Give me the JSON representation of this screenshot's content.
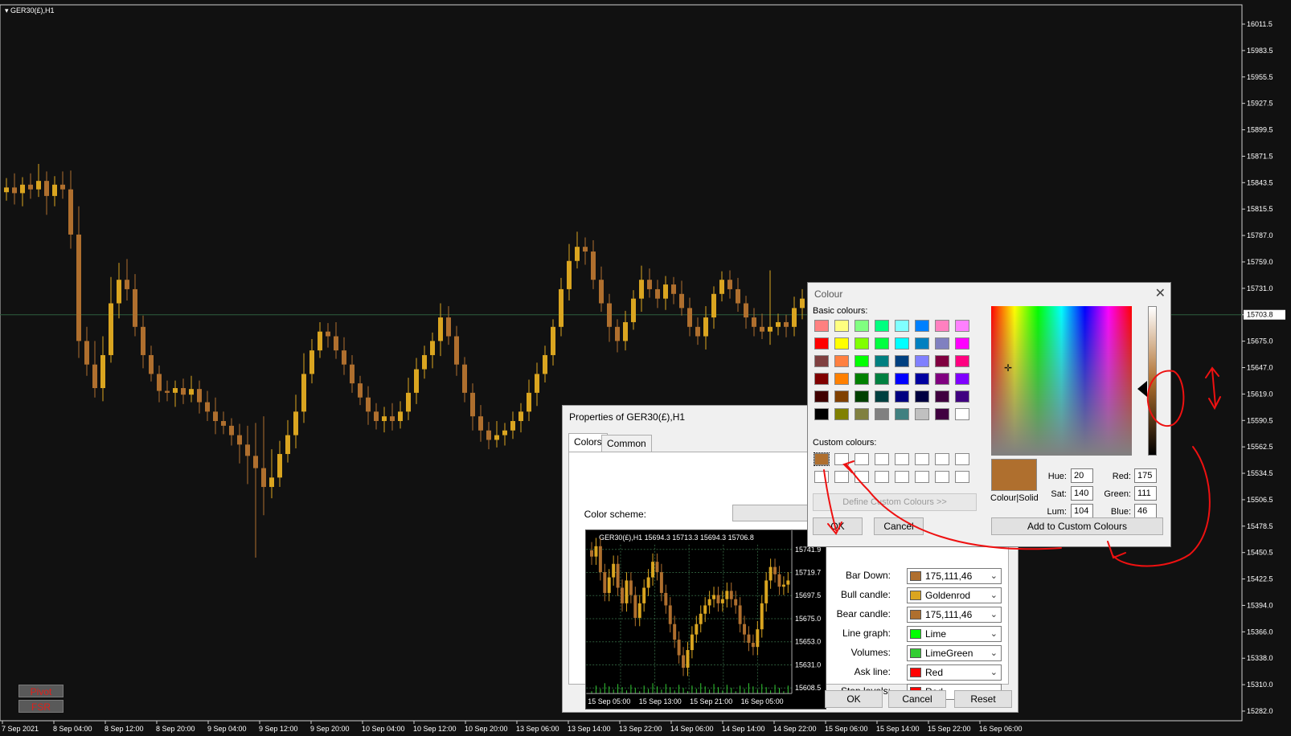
{
  "chart": {
    "title": "GER30(£),H1",
    "price_labels": [
      "16011.5",
      "15983.5",
      "15955.5",
      "15927.5",
      "15899.5",
      "15871.5",
      "15843.5",
      "15815.5",
      "15787.0",
      "15759.0",
      "15731.0",
      "15703.8",
      "15675.0",
      "15647.0",
      "15619.0",
      "15590.5",
      "15562.5",
      "15534.5",
      "15506.5",
      "15478.5",
      "15450.5",
      "15422.5",
      "15394.0",
      "15366.0",
      "15338.0",
      "15310.0",
      "15282.0"
    ],
    "current_price": "15703.8",
    "time_labels": [
      "7 Sep 2021",
      "8 Sep 04:00",
      "8 Sep 12:00",
      "8 Sep 20:00",
      "9 Sep 04:00",
      "9 Sep 12:00",
      "9 Sep 20:00",
      "10 Sep 04:00",
      "10 Sep 12:00",
      "10 Sep 20:00",
      "13 Sep 06:00",
      "13 Sep 14:00",
      "13 Sep 22:00",
      "14 Sep 06:00",
      "14 Sep 14:00",
      "14 Sep 22:00",
      "15 Sep 06:00",
      "15 Sep 14:00",
      "15 Sep 22:00",
      "16 Sep 06:00"
    ],
    "closes": [
      15838,
      15832,
      15841,
      15836,
      15845,
      15829,
      15841,
      15836,
      15788,
      15675,
      15650,
      15625,
      15660,
      15715,
      15740,
      15730,
      15690,
      15660,
      15640,
      15622,
      15620,
      15625,
      15618,
      15624,
      15610,
      15600,
      15590,
      15585,
      15575,
      15565,
      15553,
      15540,
      15520,
      15530,
      15555,
      15575,
      15600,
      15640,
      15665,
      15685,
      15680,
      15665,
      15650,
      15630,
      15615,
      15600,
      15590,
      15595,
      15590,
      15600,
      15620,
      15645,
      15660,
      15675,
      15700,
      15680,
      15650,
      15620,
      15595,
      15580,
      15570,
      15575,
      15580,
      15590,
      15600,
      15620,
      15640,
      15660,
      15690,
      15730,
      15760,
      15775,
      15770,
      15740,
      15715,
      15690,
      15675,
      15695,
      15720,
      15740,
      15730,
      15720,
      15735,
      15725,
      15710,
      15690,
      15680,
      15700,
      15725,
      15740,
      15730,
      15715,
      15700,
      15690,
      15685,
      15690,
      15695,
      15690,
      15710,
      15720
    ],
    "highs_extra": [
      10,
      15,
      8,
      12,
      18,
      10,
      9,
      14,
      20,
      30,
      15,
      25,
      20,
      28,
      18,
      22,
      16,
      12,
      10,
      9,
      11,
      8,
      10,
      14,
      9,
      12,
      15,
      10,
      8,
      12,
      20,
      35,
      55,
      30,
      14,
      16,
      18,
      22,
      12,
      10,
      9,
      15,
      14,
      10,
      8,
      12,
      9,
      10,
      14,
      11,
      16,
      12,
      10,
      9,
      15,
      12,
      11,
      8,
      10,
      12,
      9,
      15,
      8,
      10,
      9,
      14,
      12,
      10,
      8,
      12,
      18,
      16,
      10,
      12,
      14,
      10,
      8,
      12,
      9,
      15,
      12,
      10,
      9,
      8,
      14,
      11,
      10,
      12,
      8,
      9,
      10,
      12,
      8,
      10,
      14,
      60,
      9,
      8,
      12,
      10
    ],
    "lows_extra": [
      9,
      12,
      14,
      10,
      8,
      20,
      11,
      10,
      15,
      18,
      12,
      10,
      14,
      8,
      16,
      12,
      10,
      14,
      8,
      12,
      9,
      15,
      10,
      8,
      12,
      10,
      14,
      9,
      11,
      20,
      30,
      95,
      30,
      12,
      10,
      9,
      14,
      12,
      10,
      8,
      12,
      9,
      11,
      10,
      8,
      14,
      9,
      12,
      10,
      8,
      9,
      12,
      10,
      14,
      16,
      9,
      12,
      10,
      15,
      12,
      10,
      8,
      11,
      9,
      12,
      10,
      14,
      9,
      11,
      10,
      12,
      8,
      14,
      10,
      9,
      16,
      12,
      10,
      8,
      14,
      9,
      10,
      12,
      11,
      8,
      10,
      9,
      14,
      12,
      8,
      10,
      9,
      12,
      10,
      8,
      14,
      9,
      11,
      10,
      12
    ],
    "candle_colors": {
      "bull": "#daa520",
      "bear": "#af6f2e",
      "grid_line": "#2f5f3f",
      "background": "#111111"
    }
  },
  "indicators": {
    "pivot": "Pivot",
    "fsr": "FSR"
  },
  "properties_dialog": {
    "title": "Properties of GER30(£),H1",
    "tabs": [
      "Colors",
      "Common"
    ],
    "color_scheme_label": "Color scheme:",
    "preview": {
      "header": "GER30(£),H1  15694.3 15713.3 15694.3 15706.8",
      "price_labels": [
        "15741.9",
        "15719.7",
        "15697.5",
        "15675.0",
        "15653.0",
        "15631.0",
        "15608.5"
      ],
      "current_price": "15706.8",
      "time_labels": [
        "15 Sep 05:00",
        "15 Sep 13:00",
        "15 Sep 21:00",
        "16 Sep 05:00"
      ],
      "closes": [
        15735,
        15745,
        15720,
        15700,
        15715,
        15728,
        15705,
        15690,
        15712,
        15698,
        15676,
        15690,
        15705,
        15715,
        15730,
        15720,
        15700,
        15688,
        15670,
        15655,
        15640,
        15628,
        15645,
        15660,
        15670,
        15680,
        15688,
        15694,
        15698,
        15690,
        15694,
        15702,
        15694,
        15688,
        15670,
        15660,
        15652,
        15648,
        15665,
        15690,
        15712,
        15725,
        15718,
        15706,
        15708,
        15712
      ]
    },
    "rows": [
      {
        "label": "Bar Down:",
        "value": "175,111,46",
        "color": "#af6f2e"
      },
      {
        "label": "Bull candle:",
        "value": "Goldenrod",
        "color": "#daa520"
      },
      {
        "label": "Bear candle:",
        "value": "175,111,46",
        "color": "#af6f2e"
      },
      {
        "label": "Line graph:",
        "value": "Lime",
        "color": "#00ff00"
      },
      {
        "label": "Volumes:",
        "value": "LimeGreen",
        "color": "#32cd32"
      },
      {
        "label": "Ask line:",
        "value": "Red",
        "color": "#ff0000"
      },
      {
        "label": "Stop levels:",
        "value": "Red",
        "color": "#ff0000"
      }
    ],
    "buttons": {
      "ok": "OK",
      "cancel": "Cancel",
      "reset": "Reset"
    }
  },
  "colour_dialog": {
    "title": "Colour",
    "basic_label": "Basic colours:",
    "custom_label": "Custom colours:",
    "basic_colours": [
      "#ff8080",
      "#ffff80",
      "#80ff80",
      "#00ff80",
      "#80ffff",
      "#0080ff",
      "#ff80c0",
      "#ff80ff",
      "#ff0000",
      "#ffff00",
      "#80ff00",
      "#00ff40",
      "#00ffff",
      "#0080c0",
      "#8080c0",
      "#ff00ff",
      "#804040",
      "#ff8040",
      "#00ff00",
      "#008080",
      "#004080",
      "#8080ff",
      "#800040",
      "#ff0080",
      "#800000",
      "#ff8000",
      "#008000",
      "#008040",
      "#0000ff",
      "#0000a0",
      "#800080",
      "#8000ff",
      "#400000",
      "#804000",
      "#004000",
      "#004040",
      "#000080",
      "#000040",
      "#400040",
      "#400080",
      "#000000",
      "#808000",
      "#808040",
      "#808080",
      "#408080",
      "#c0c0c0",
      "#400040",
      "#ffffff"
    ],
    "custom_colours": [
      "#af6f2e",
      "#ffffff",
      "#ffffff",
      "#ffffff",
      "#ffffff",
      "#ffffff",
      "#ffffff",
      "#ffffff",
      "#ffffff",
      "#ffffff",
      "#ffffff",
      "#ffffff",
      "#ffffff",
      "#ffffff",
      "#ffffff",
      "#ffffff"
    ],
    "define_button": "Define Custom Colours >>",
    "solid_label": "Colour|Solid",
    "hue_label": "Hue:",
    "hue": "20",
    "sat_label": "Sat:",
    "sat": "140",
    "lum_label": "Lum:",
    "lum": "104",
    "red_label": "Red:",
    "red": "175",
    "green_label": "Green:",
    "green": "111",
    "blue_label": "Blue:",
    "blue": "46",
    "ok": "OK",
    "cancel": "Cancel",
    "add_button": "Add to Custom Colours"
  }
}
